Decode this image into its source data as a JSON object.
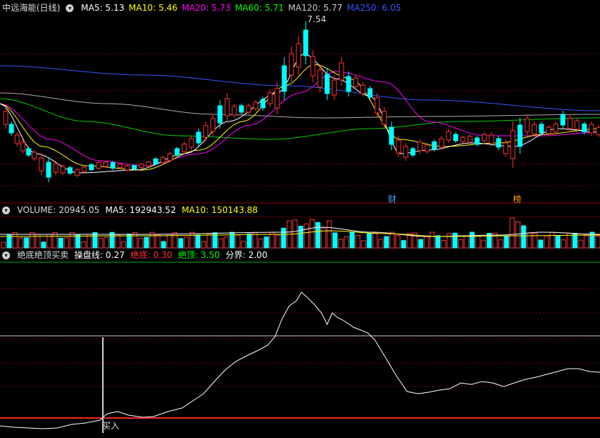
{
  "main_panel": {
    "title": "中远海能(日线)",
    "indicators": [
      {
        "label": "MA5: 5.13",
        "color": "#ffffff"
      },
      {
        "label": "MA10: 5.46",
        "color": "#ffff00"
      },
      {
        "label": "MA20: 5.73",
        "color": "#ff00ff"
      },
      {
        "label": "MA60: 5.71",
        "color": "#00ff00"
      },
      {
        "label": "MA120: 5.77",
        "color": "#cccccc"
      },
      {
        "label": "MA250: 6.05",
        "color": "#3355ff"
      }
    ],
    "peak_label": "7.54",
    "markers": [
      {
        "label": "财",
        "color": "#4a9fff"
      },
      {
        "label": "榜",
        "color": "#ff9900"
      }
    ]
  },
  "volume_panel": {
    "title": "VOLUME: 20945.05",
    "indicators": [
      {
        "label": "MA5: 192943.52",
        "color": "#ffffff"
      },
      {
        "label": "MA10: 150143.88",
        "color": "#ffff00"
      }
    ]
  },
  "indicator_panel": {
    "title": "绝底绝顶买卖",
    "indicators": [
      {
        "label": "操盘线: 0.27",
        "color": "#ffffff"
      },
      {
        "label": "绝底: 0.30",
        "color": "#ff3333"
      },
      {
        "label": "绝顶: 3.50",
        "color": "#00ff00"
      },
      {
        "label": "分界: 2.00",
        "color": "#ffffff"
      }
    ],
    "buy_label": "买入"
  },
  "colors": {
    "up": "#ff3333",
    "down": "#00ffff",
    "grid": "#7a0000",
    "border": "#8b0000"
  }
}
